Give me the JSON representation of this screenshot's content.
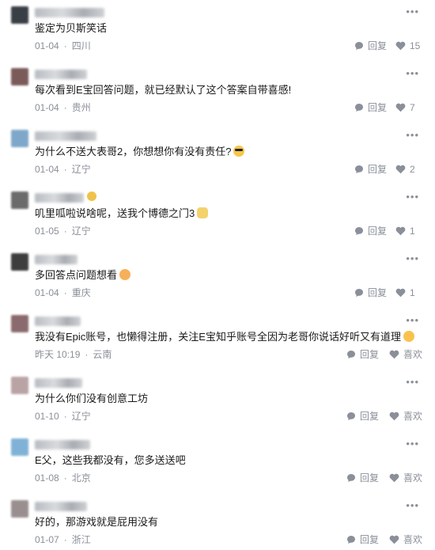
{
  "icons": {
    "more": "more-dots-icon",
    "reply": "comment-bubble-icon",
    "like": "heart-icon"
  },
  "colors": {
    "meta": "#8a8f99",
    "text": "#1a1a1a"
  },
  "comments": [
    {
      "text": "鉴定为贝斯笑话",
      "date": "01-04",
      "location": "四川",
      "reply_label": "回复",
      "like_label": "15",
      "has_emoji": false
    },
    {
      "text": "每次看到E宝回答问题，就已经默认了这个答案自带喜感!",
      "date": "01-04",
      "location": "贵州",
      "reply_label": "回复",
      "like_label": "7",
      "has_emoji": false
    },
    {
      "text": "为什么不送大表哥2，你想想你有没有责任?",
      "date": "01-04",
      "location": "辽宁",
      "reply_label": "回复",
      "like_label": "2",
      "has_emoji": true
    },
    {
      "text": "叽里呱啦说啥呢，送我个博德之门3",
      "date": "01-05",
      "location": "辽宁",
      "reply_label": "回复",
      "like_label": "1",
      "has_emoji": true
    },
    {
      "text": "多回答点问题想看",
      "date": "01-04",
      "location": "重庆",
      "reply_label": "回复",
      "like_label": "1",
      "has_emoji": true
    },
    {
      "text": "我没有Epic账号，也懒得注册，关注E宝知乎账号全因为老哥你说话好听又有道理",
      "date": "昨天 10:19",
      "location": "云南",
      "reply_label": "回复",
      "like_label": "喜欢",
      "has_emoji": true
    },
    {
      "text": "为什么你们没有创意工坊",
      "date": "01-10",
      "location": "辽宁",
      "reply_label": "回复",
      "like_label": "喜欢",
      "has_emoji": false
    },
    {
      "text": "E父，这些我都没有，您多送送吧",
      "date": "01-08",
      "location": "北京",
      "reply_label": "回复",
      "like_label": "喜欢",
      "has_emoji": false
    },
    {
      "text": "好的，那游戏就是屁用没有",
      "date": "01-07",
      "location": "浙江",
      "reply_label": "回复",
      "like_label": "喜欢",
      "has_emoji": false
    }
  ]
}
